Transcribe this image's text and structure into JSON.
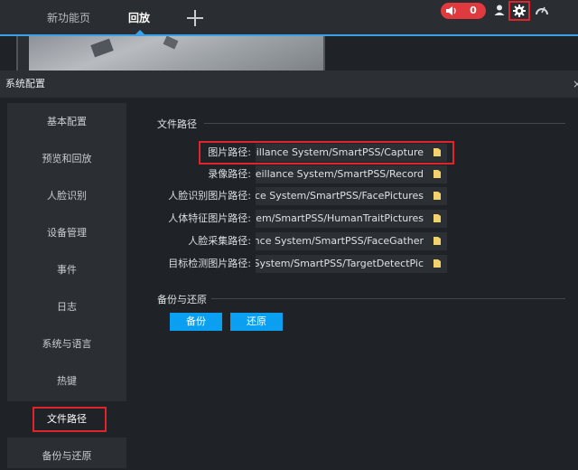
{
  "topbar": {
    "tabs": [
      {
        "label": "新功能页",
        "active": false
      },
      {
        "label": "回放",
        "active": true
      }
    ],
    "alarm_count": "0",
    "colors": {
      "accent": "#3aa0e8",
      "alarm": "#e03a3e",
      "highlight": "#e0242a"
    }
  },
  "dialog": {
    "title": "系统配置",
    "close_label": "×"
  },
  "sidebar": {
    "items": [
      {
        "label": "基本配置"
      },
      {
        "label": "预览和回放"
      },
      {
        "label": "人脸识别"
      },
      {
        "label": "设备管理"
      },
      {
        "label": "事件"
      },
      {
        "label": "日志"
      },
      {
        "label": "系统与语言"
      },
      {
        "label": "热键"
      },
      {
        "label": "文件路径",
        "selected": true
      },
      {
        "label": "备份与还原"
      }
    ]
  },
  "file_paths": {
    "section_title": "文件路径",
    "rows": [
      {
        "label": "图片路径:",
        "value": "Surveillance System/SmartPSS/Capture",
        "icon": "folder-icon"
      },
      {
        "label": "录像路径:",
        "value": "Surveillance System/SmartPSS/Record",
        "icon": "folder-icon"
      },
      {
        "label": "人脸识别图片路径:",
        "value": "eillance System/SmartPSS/FacePictures",
        "icon": "folder-icon"
      },
      {
        "label": "人体特征图片路径:",
        "value": "System/SmartPSS/HumanTraitPictures",
        "icon": "folder-icon"
      },
      {
        "label": "人脸采集路径:",
        "value": "veillance System/SmartPSS/FaceGather",
        "icon": "folder-icon"
      },
      {
        "label": "目标检测图片路径:",
        "value": "nce System/SmartPSS/TargetDetectPic",
        "icon": "folder-icon"
      }
    ]
  },
  "backup": {
    "section_title": "备份与还原",
    "backup_label": "备份",
    "restore_label": "还原"
  }
}
